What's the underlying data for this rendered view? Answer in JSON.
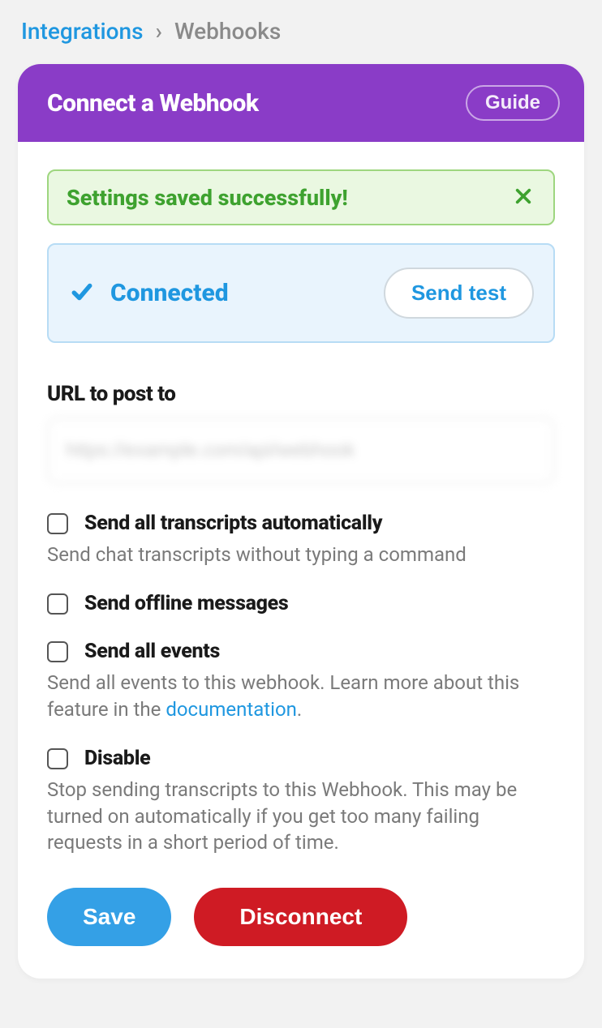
{
  "breadcrumb": {
    "parent": "Integrations",
    "separator": "›",
    "current": "Webhooks"
  },
  "header": {
    "title": "Connect a Webhook",
    "guide_label": "Guide"
  },
  "alert": {
    "message": "Settings saved successfully!"
  },
  "status": {
    "label": "Connected",
    "send_test_label": "Send test"
  },
  "url_field": {
    "label": "URL to post to",
    "value": "https://example.com/api/webhook"
  },
  "options": [
    {
      "title": "Send all transcripts automatically",
      "desc_pre": "Send chat transcripts without typing a command",
      "link_text": "",
      "desc_post": ""
    },
    {
      "title": "Send offline messages",
      "desc_pre": "",
      "link_text": "",
      "desc_post": ""
    },
    {
      "title": "Send all events",
      "desc_pre": "Send all events to this webhook. Learn more about this feature in the ",
      "link_text": "documentation",
      "desc_post": "."
    },
    {
      "title": "Disable",
      "desc_pre": "Stop sending transcripts to this Webhook. This may be turned on automatically if you get too many failing requests in a short period of time.",
      "link_text": "",
      "desc_post": ""
    }
  ],
  "actions": {
    "save_label": "Save",
    "disconnect_label": "Disconnect"
  }
}
